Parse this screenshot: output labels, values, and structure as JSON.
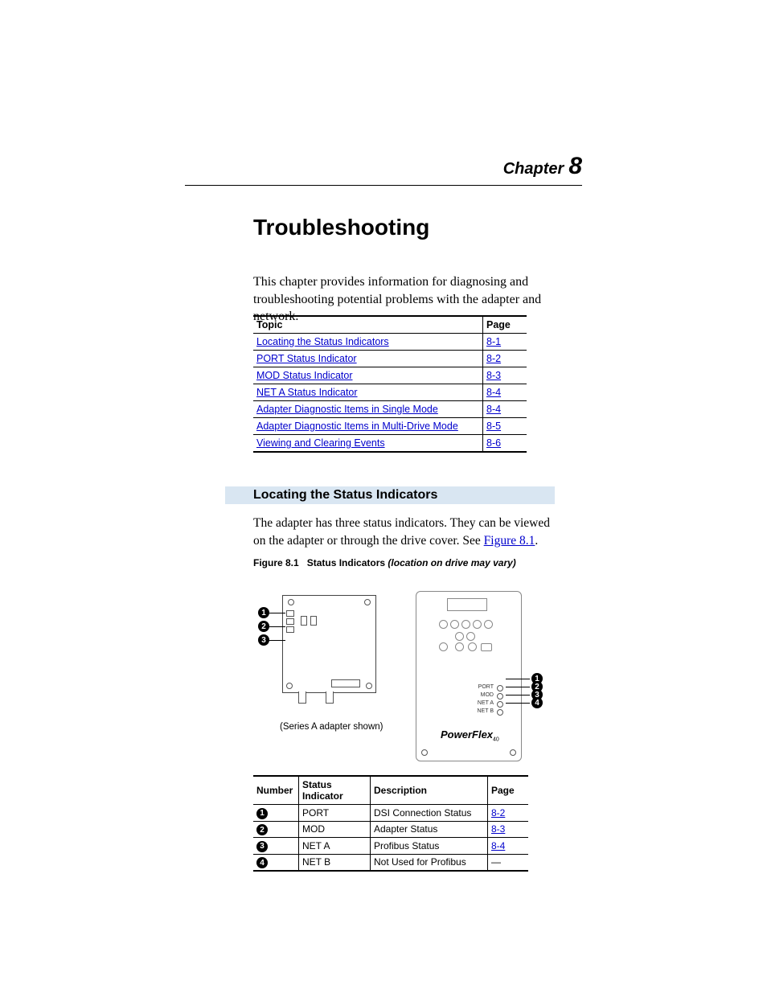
{
  "chapter": {
    "label": "Chapter",
    "number": "8"
  },
  "title": "Troubleshooting",
  "intro": "This chapter provides information for diagnosing and troubleshooting potential problems with the adapter and network.",
  "topics": {
    "header": {
      "topic": "Topic",
      "page": "Page"
    },
    "rows": [
      {
        "topic": "Locating the Status Indicators",
        "page": "8-1"
      },
      {
        "topic": "PORT Status Indicator",
        "page": "8-2"
      },
      {
        "topic": "MOD Status Indicator",
        "page": "8-3"
      },
      {
        "topic": "NET A Status Indicator",
        "page": "8-4"
      },
      {
        "topic": "Adapter Diagnostic Items in Single Mode",
        "page": "8-4"
      },
      {
        "topic": "Adapter Diagnostic Items in Multi-Drive Mode",
        "page": "8-5"
      },
      {
        "topic": "Viewing and Clearing Events",
        "page": "8-6"
      }
    ]
  },
  "section": {
    "title": "Locating the Status Indicators",
    "text_pre": "The adapter has three status indicators. They can be viewed on the adapter or through the drive cover. See ",
    "text_link": "Figure 8.1",
    "text_post": "."
  },
  "figure": {
    "label": "Figure 8.1",
    "title": "Status Indicators",
    "note_italic": "(location on drive may vary)",
    "adapter_note": "(Series A adapter shown)",
    "drive_labels": {
      "port": "PORT",
      "mod": "MOD",
      "neta": "NET A",
      "netb": "NET B"
    },
    "brand": "PowerFlex",
    "brand_sub": "40",
    "callouts": {
      "c1": "1",
      "c2": "2",
      "c3": "3",
      "c4": "4"
    }
  },
  "status_table": {
    "header": {
      "number": "Number",
      "indicator": "Status Indicator",
      "description": "Description",
      "page": "Page"
    },
    "rows": [
      {
        "num": "1",
        "indicator": "PORT",
        "desc": "DSI Connection Status",
        "page": "8-2",
        "linked": true
      },
      {
        "num": "2",
        "indicator": "MOD",
        "desc": "Adapter Status",
        "page": "8-3",
        "linked": true
      },
      {
        "num": "3",
        "indicator": "NET A",
        "desc": "Profibus Status",
        "page": "8-4",
        "linked": true
      },
      {
        "num": "4",
        "indicator": "NET B",
        "desc": "Not Used for Profibus",
        "page": "—",
        "linked": false
      }
    ]
  }
}
